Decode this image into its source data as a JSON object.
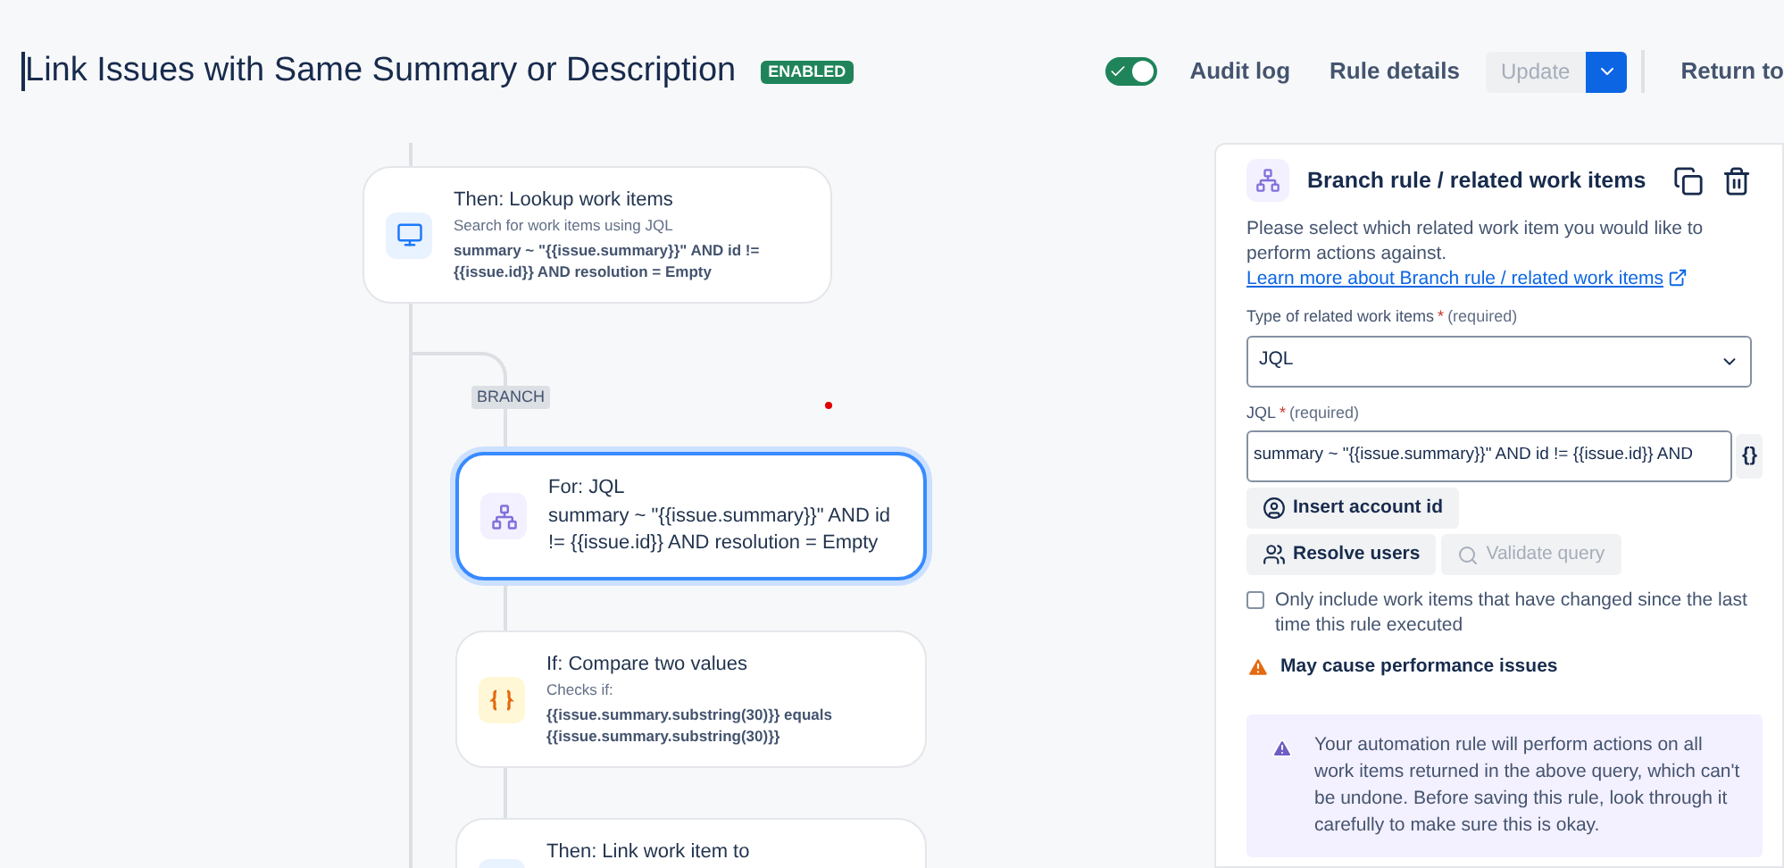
{
  "header": {
    "title": "Link Issues with Same Summary or Description",
    "status_badge": "ENABLED",
    "toggle": {
      "on": true
    },
    "links": [
      "Audit log",
      "Rule details"
    ],
    "update_button": {
      "label": "Update",
      "disabled": true
    },
    "return_link": "Return to"
  },
  "canvas": {
    "branch_label": "BRANCH",
    "nodes": [
      {
        "kind": "lookup",
        "title": "Then: Lookup work items",
        "subtitle": "Search for work items using JQL",
        "detail": "summary ~ \"{{issue.summary}}\" AND id != {{issue.id}} AND resolution = Empty",
        "selected": false
      },
      {
        "kind": "branch",
        "title": "For: JQL",
        "description": "summary ~ \"{{issue.summary}}\" AND id != {{issue.id}} AND resolution = Empty",
        "selected": true
      },
      {
        "kind": "condition",
        "title": "If: Compare two values",
        "subtitle": "Checks if:",
        "detail": "{{issue.summary.substring(30)}} equals {{issue.summary.substring(30)}}",
        "selected": false
      },
      {
        "kind": "link",
        "title": "Then: Link work item to",
        "selected": false
      }
    ]
  },
  "panel": {
    "title": "Branch rule / related work items",
    "intro": "Please select which related work item you would like to perform actions against.",
    "learn_link": "Learn more about Branch rule / related work items",
    "type_field": {
      "label": "Type of related work items",
      "required_mark": "*",
      "required_note": "(required)",
      "value": "JQL"
    },
    "jql_field": {
      "label": "JQL",
      "required_mark": "*",
      "required_note": "(required)",
      "value": "summary ~ \"{{issue.summary}}\" AND id != {{issue.id}} AND",
      "smart_value_button": "{}"
    },
    "buttons": [
      {
        "label": "Insert account id",
        "kind": "account",
        "disabled": false
      },
      {
        "label": "Resolve users",
        "kind": "users",
        "disabled": false
      },
      {
        "label": "Validate query",
        "kind": "search",
        "disabled": true
      }
    ],
    "checkbox": {
      "label": "Only include work items that have changed since the last time this rule executed",
      "checked": false
    },
    "warning": "May cause performance issues",
    "notice": "Your automation rule will perform actions on all work items returned in the above query, which can't be undone. Before saving this rule, look through it carefully to make sure this is okay."
  }
}
